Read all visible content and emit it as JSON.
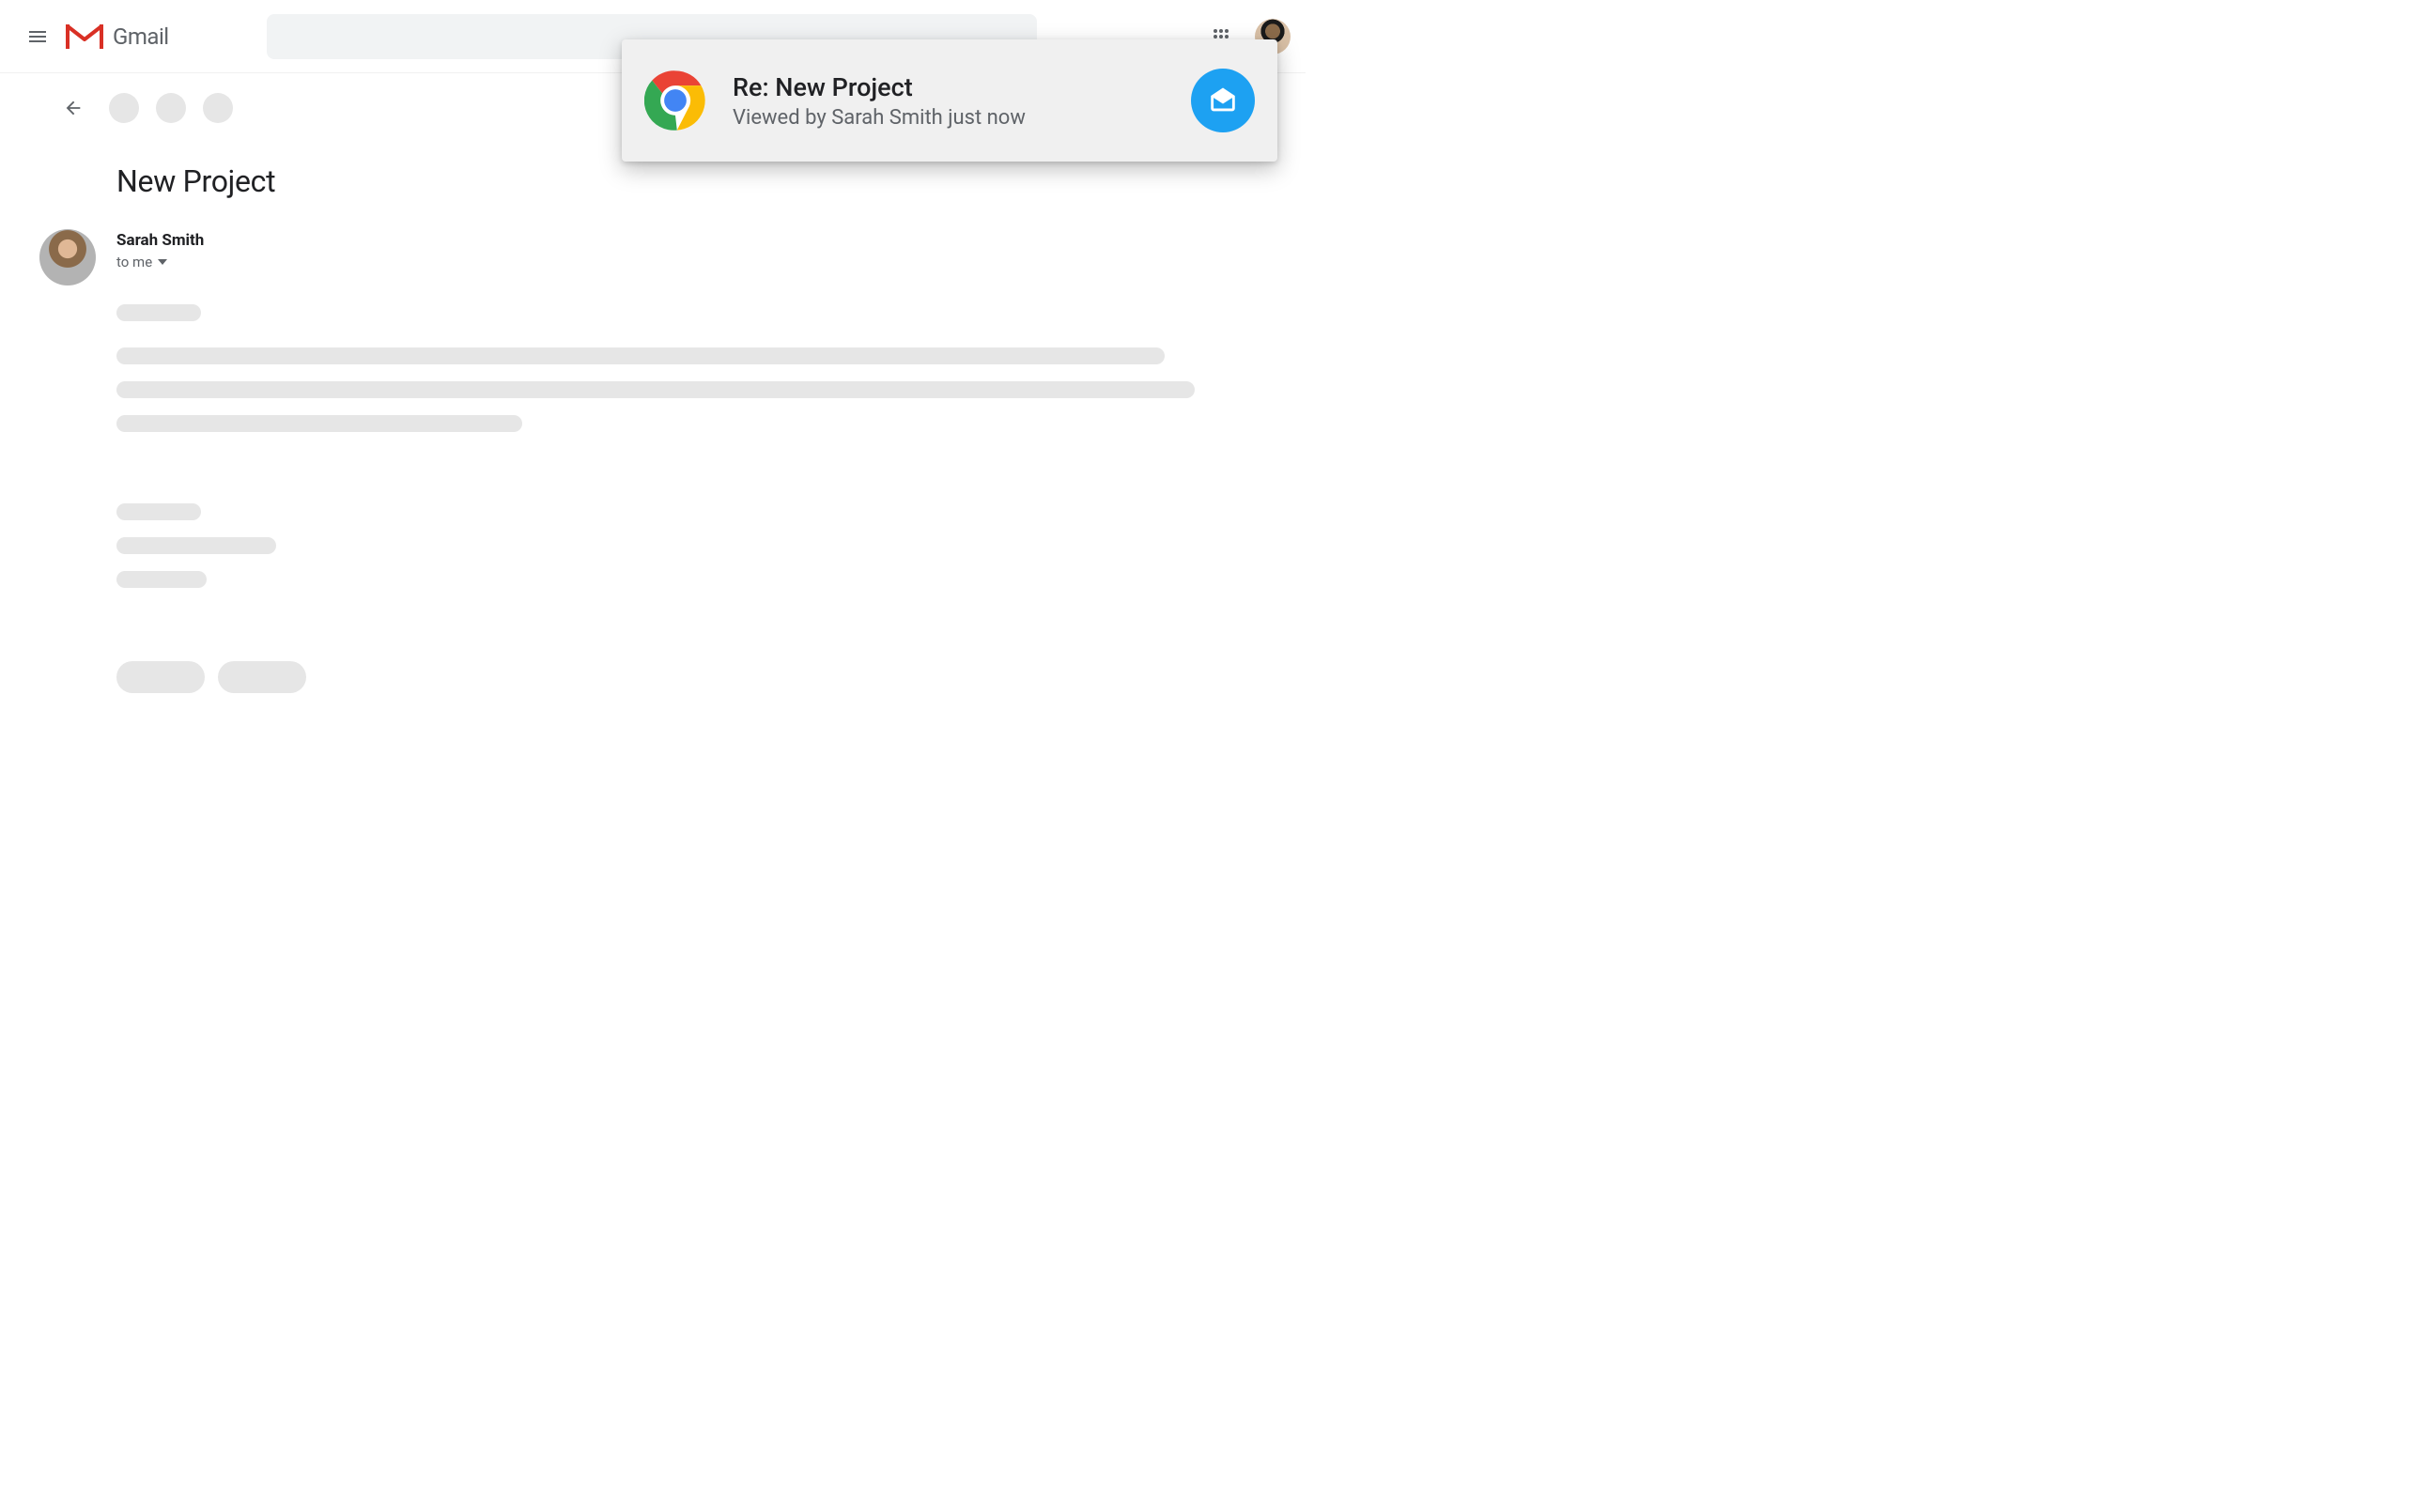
{
  "header": {
    "product": "Gmail"
  },
  "email": {
    "subject": "New Project",
    "sender": "Sarah Smith",
    "recipients_label": "to me"
  },
  "notification": {
    "title": "Re: New Project",
    "subtitle": "Viewed by Sarah Smith just now"
  }
}
